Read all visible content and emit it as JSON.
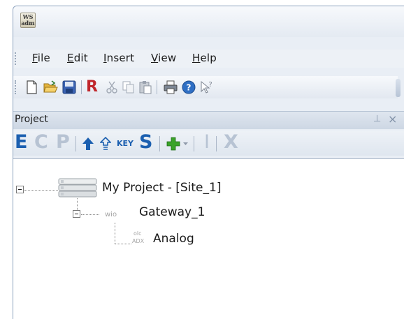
{
  "app": {
    "icon_text": "WS\nadm"
  },
  "menu": {
    "items": [
      {
        "key": "F",
        "rest": "ile"
      },
      {
        "key": "E",
        "rest": "dit"
      },
      {
        "key": "I",
        "rest": "nsert"
      },
      {
        "key": "V",
        "rest": "iew"
      },
      {
        "key": "H",
        "rest": "elp"
      }
    ]
  },
  "toolbar": {
    "icons": [
      "new-document-icon",
      "open-folder-icon",
      "save-icon",
      "r-icon",
      "cut-icon",
      "copy-icon",
      "paste-icon",
      "print-icon",
      "help-icon",
      "pointer-help-icon"
    ],
    "r_label": "R"
  },
  "panel": {
    "title": "Project",
    "pin_glyph": "⊥",
    "close_glyph": "×",
    "tools": {
      "e": "E",
      "c": "C",
      "p": "P",
      "key": "KEY",
      "s": "S",
      "bar": "I",
      "x": "X"
    },
    "colors": {
      "e": "#1b5fb0",
      "s": "#1b5fb0",
      "disabled": "#b7c3d3",
      "add": "#3aa329"
    }
  },
  "tree": {
    "root": {
      "label": "My Project - [Site_1]"
    },
    "gateway": {
      "prefix": "wio",
      "label": "Gateway_1"
    },
    "analog": {
      "prefix_top": "olc",
      "prefix_bottom": "ADX",
      "label": "Analog"
    }
  }
}
